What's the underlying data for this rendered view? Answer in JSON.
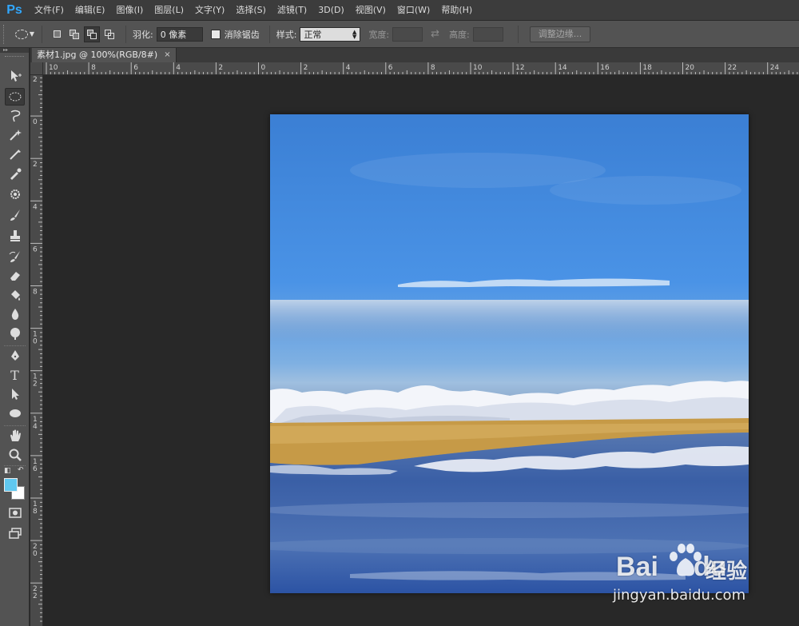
{
  "app": {
    "logo": "Ps"
  },
  "menu": [
    "文件(F)",
    "编辑(E)",
    "图像(I)",
    "图层(L)",
    "文字(Y)",
    "选择(S)",
    "滤镜(T)",
    "3D(D)",
    "视图(V)",
    "窗口(W)",
    "帮助(H)"
  ],
  "options": {
    "feather_label": "羽化:",
    "feather_value": "0 像素",
    "antialias_label": "消除锯齿",
    "style_label": "样式:",
    "style_value": "正常",
    "width_label": "宽度:",
    "height_label": "高度:",
    "refine_edge_label": "调整边缘..."
  },
  "document": {
    "tab_title": "素材1.jpg @ 100%(RGB/8#)",
    "close_symbol": "×"
  },
  "ruler": {
    "horizontal": [
      "10",
      "8",
      "6",
      "4",
      "2",
      "0",
      "2",
      "4",
      "6",
      "8",
      "10",
      "12",
      "14",
      "16",
      "18",
      "20",
      "22",
      "24"
    ],
    "vertical": [
      [
        "2"
      ],
      [
        "0"
      ],
      [
        "2"
      ],
      [
        "4"
      ],
      [
        "6"
      ],
      [
        "8"
      ],
      [
        "1",
        "0"
      ],
      [
        "1",
        "2"
      ],
      [
        "1",
        "4"
      ],
      [
        "1",
        "6"
      ],
      [
        "1",
        "8"
      ],
      [
        "2",
        "0"
      ],
      [
        "2",
        "2"
      ]
    ]
  },
  "tools": [
    "move-tool",
    "elliptical-marquee-tool",
    "lasso-tool",
    "magic-wand-tool",
    "crop-tool",
    "eyedropper-tool",
    "spot-healing-tool",
    "brush-tool",
    "clone-stamp-tool",
    "history-brush-tool",
    "eraser-tool",
    "paint-bucket-tool",
    "blur-tool",
    "dodge-tool",
    "pen-tool",
    "type-tool",
    "path-selection-tool",
    "ellipse-shape-tool",
    "hand-tool",
    "zoom-tool"
  ],
  "colors": {
    "foreground": "#60c8f0",
    "background": "#ffffff",
    "accent": "#31a8ff"
  },
  "watermark": {
    "brand": "Bai",
    "brand_suffix": "du",
    "cn": "经验",
    "url": "jingyan.baidu.com"
  }
}
